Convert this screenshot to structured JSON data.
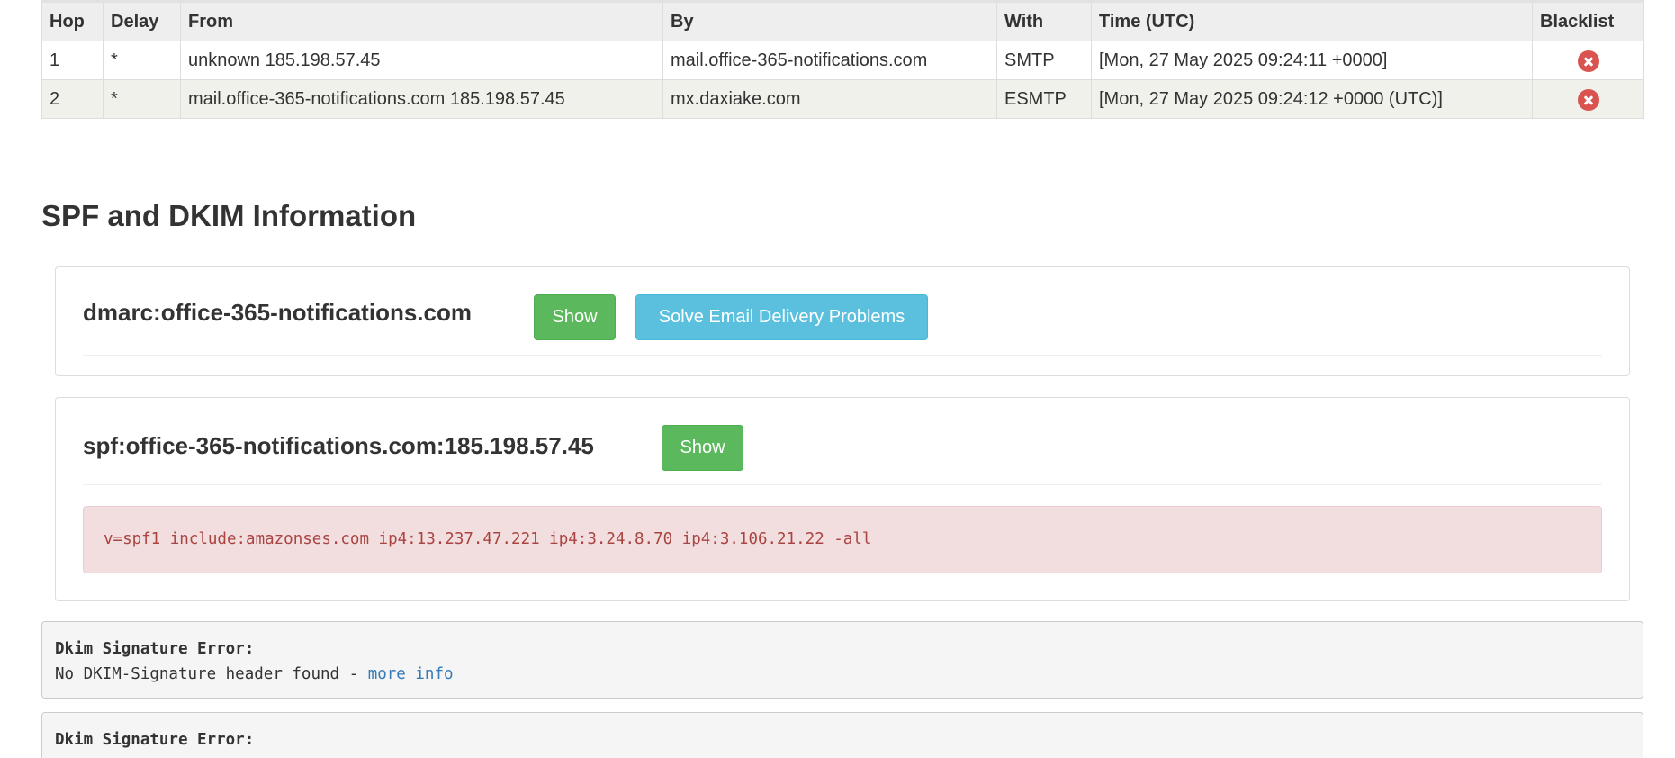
{
  "hops_table": {
    "headers": {
      "hop": "Hop",
      "delay": "Delay",
      "from": "From",
      "by": "By",
      "with": "With",
      "time": "Time (UTC)",
      "blacklist": "Blacklist"
    },
    "rows": [
      {
        "hop": "1",
        "delay": "*",
        "from": "unknown 185.198.57.45",
        "by": "mail.office-365-notifications.com",
        "with": "SMTP",
        "time": "[Mon, 27 May 2025 09:24:11 +0000]",
        "blacklist_icon": "error-circle-icon"
      },
      {
        "hop": "2",
        "delay": "*",
        "from": "mail.office-365-notifications.com 185.198.57.45",
        "by": "mx.daxiake.com",
        "with": "ESMTP",
        "time": "[Mon, 27 May 2025 09:24:12 +0000 (UTC)]",
        "blacklist_icon": "error-circle-icon"
      }
    ]
  },
  "section": {
    "title": "SPF and DKIM Information"
  },
  "dmarc_panel": {
    "title": "dmarc:office-365-notifications.com",
    "show_label": "Show",
    "solve_label": "Solve Email Delivery Problems"
  },
  "spf_panel": {
    "title": "spf:office-365-notifications.com:185.198.57.45",
    "show_label": "Show",
    "record": "v=spf1 include:amazonses.com ip4:13.237.47.221 ip4:3.24.8.70 ip4:3.106.21.22 -all"
  },
  "dkim_errors": [
    {
      "label": "Dkim Signature Error:",
      "message": "No DKIM-Signature header found - ",
      "link": "more info"
    },
    {
      "label": "Dkim Signature Error:"
    }
  ],
  "colors": {
    "success": "#5cb85c",
    "info": "#5bc0de",
    "danger": "#d9534f",
    "alert_bg": "#f2dede",
    "alert_text": "#a94442",
    "link": "#337ab7"
  }
}
